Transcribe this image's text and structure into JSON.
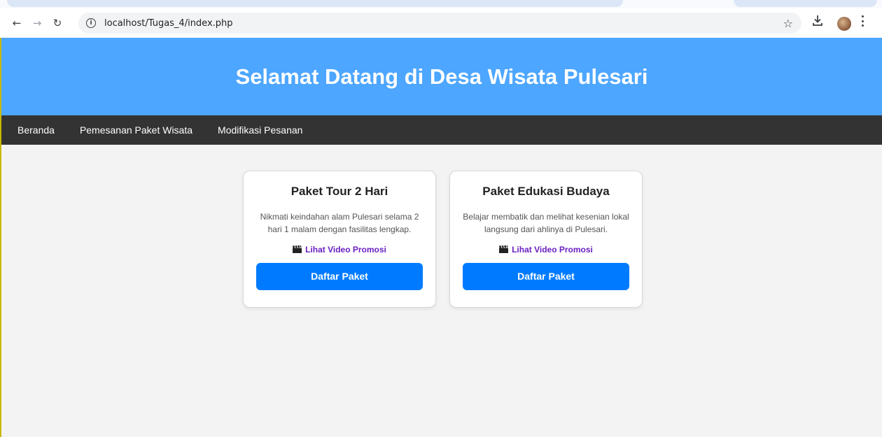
{
  "browser": {
    "url": "localhost/Tugas_4/index.php"
  },
  "header": {
    "title": "Selamat Datang di Desa Wisata Pulesari"
  },
  "nav": {
    "items": [
      {
        "label": "Beranda"
      },
      {
        "label": "Pemesanan Paket Wisata"
      },
      {
        "label": "Modifikasi Pesanan"
      }
    ]
  },
  "cards": [
    {
      "title": "Paket Tour 2 Hari",
      "description": "Nikmati keindahan alam Pulesari selama 2 hari 1 malam dengan fasilitas lengkap.",
      "promo_label": "Lihat Video Promosi",
      "button_label": "Daftar Paket"
    },
    {
      "title": "Paket Edukasi Budaya",
      "description": "Belajar membatik dan melihat kesenian lokal langsung dari ahlinya di Pulesari.",
      "promo_label": "Lihat Video Promosi",
      "button_label": "Daftar Paket"
    }
  ],
  "icons": {
    "promo": "clapper-board-icon",
    "back": "arrow-left-icon",
    "forward": "arrow-right-icon",
    "reload": "reload-icon",
    "bookmark": "star-icon",
    "download": "download-icon",
    "menu": "kebab-menu-icon"
  },
  "colors": {
    "hero": "#4da6ff",
    "nav": "#333333",
    "button": "#007bff",
    "promo_link": "#6a1fbf"
  }
}
